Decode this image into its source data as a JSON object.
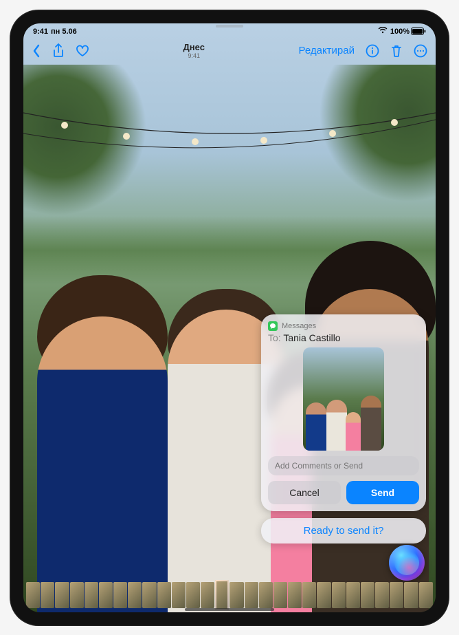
{
  "status": {
    "time": "9:41",
    "day": "пн 5.06",
    "battery_pct": "100%"
  },
  "toolbar": {
    "title": "Днес",
    "subtitle": "9:41",
    "edit": "Редактирай"
  },
  "siri": {
    "app_label": "Messages",
    "to_label": "To:",
    "to_name": "Tania Castillo",
    "comment_placeholder": "Add Comments or Send",
    "cancel": "Cancel",
    "send": "Send",
    "prompt": "Ready to send it?"
  }
}
